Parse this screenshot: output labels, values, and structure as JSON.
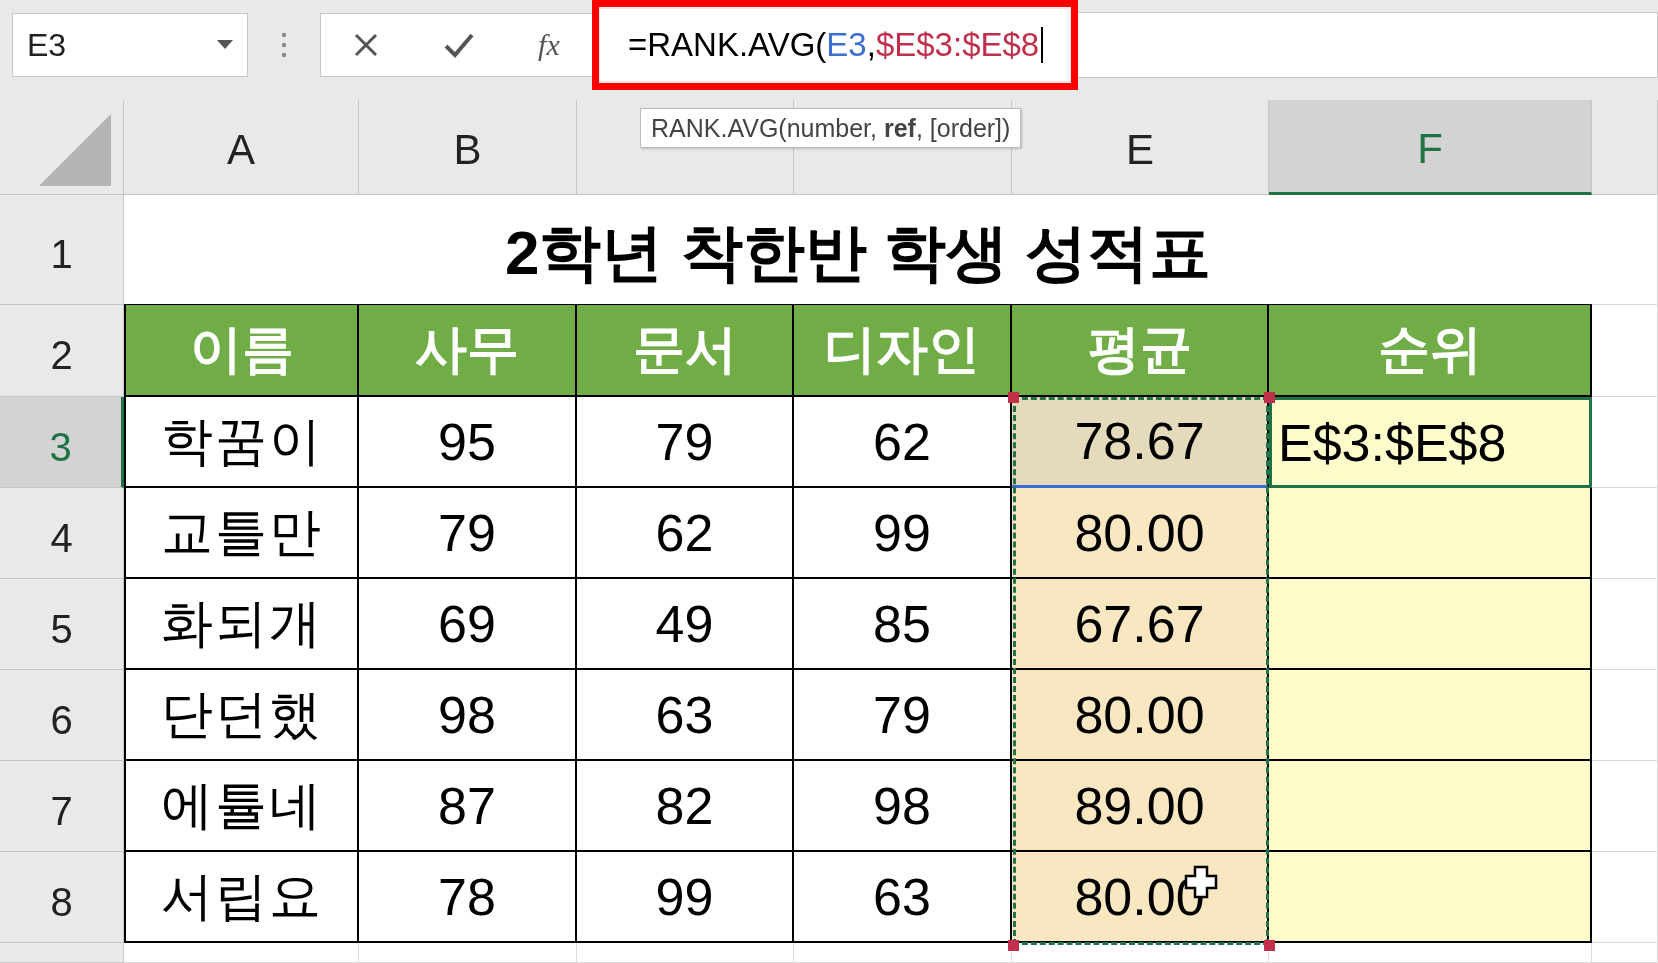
{
  "name_box": {
    "value": "E3"
  },
  "function_label": "fx",
  "formula": {
    "parts": [
      {
        "text": "=RANK.AVG(",
        "color": "#000000"
      },
      {
        "text": "E3",
        "color": "#3b6fd0"
      },
      {
        "text": ",",
        "color": "#000000"
      },
      {
        "text": "$E$3:$E$8",
        "color": "#c0304a"
      }
    ],
    "highlighted": true
  },
  "tooltip": "RANK.AVG(number, **ref**, [order])",
  "columns": [
    {
      "label": "A",
      "selected": false
    },
    {
      "label": "B",
      "selected": false
    },
    {
      "selected": false
    },
    {
      "selected": false
    },
    {
      "label": "E",
      "selected": false
    },
    {
      "label": "F",
      "selected": true
    }
  ],
  "row_headers": [
    {
      "label": "1",
      "selected": false
    },
    {
      "label": "2",
      "selected": false
    },
    {
      "label": "3",
      "selected": true
    },
    {
      "label": "4",
      "selected": false
    },
    {
      "label": "5",
      "selected": false
    },
    {
      "label": "6",
      "selected": false
    },
    {
      "label": "7",
      "selected": false
    },
    {
      "label": "8",
      "selected": false
    }
  ],
  "title": "2학년 착한반 학생 성적표",
  "header": [
    "이름",
    "사무",
    "문서",
    "디자인",
    "평균",
    "순위"
  ],
  "rows": [
    {
      "name": "학꿈이",
      "scores": [
        "95",
        "79",
        "62"
      ],
      "average": "78.67",
      "rank": "E$3:$E$8",
      "active": true
    },
    {
      "name": "교틀만",
      "scores": [
        "79",
        "62",
        "99"
      ],
      "average": "80.00",
      "active": false
    },
    {
      "name": "화되개",
      "scores": [
        "69",
        "49",
        "85"
      ],
      "average": "67.67",
      "active": false
    },
    {
      "name": "단던했",
      "scores": [
        "98",
        "63",
        "79"
      ],
      "average": "80.00",
      "active": false
    },
    {
      "name": "에튤네",
      "scores": [
        "87",
        "82",
        "98"
      ],
      "average": "89.00",
      "active": false
    },
    {
      "name": "서립요",
      "scores": [
        "78",
        "99",
        "63"
      ],
      "average": "80.00",
      "active": false
    }
  ]
}
